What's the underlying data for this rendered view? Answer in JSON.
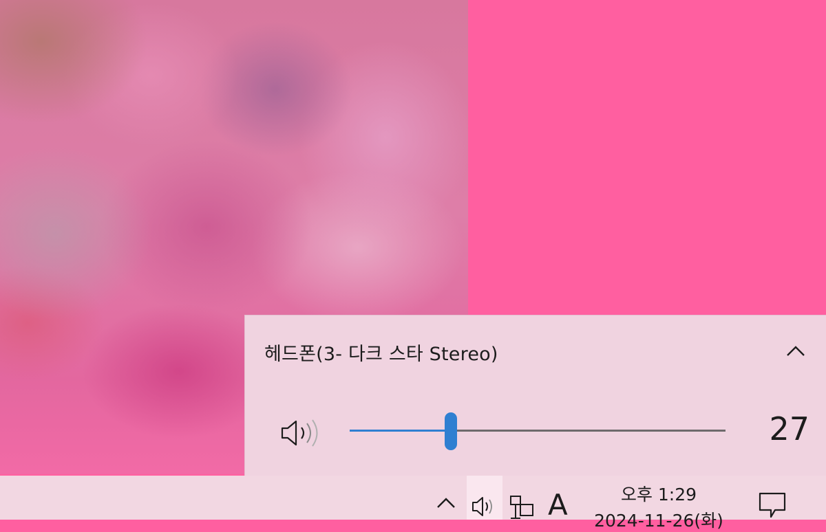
{
  "colors": {
    "wallpaper": "#ff5fa0",
    "flyout_background": "#f0d3e0",
    "taskbar_background": "#f2d7e2",
    "accent": "#2f7fd1",
    "text": "#1c1c1c"
  },
  "volume_flyout": {
    "device_name": "헤드폰(3- 다크 스타 Stereo)",
    "expand_icon": "chevron-up-icon",
    "speaker_icon": "speaker-icon",
    "volume": 27,
    "volume_fraction": 0.27
  },
  "taskbar": {
    "tray_icons": [
      "chevron-up-icon",
      "speaker-icon",
      "network-icon"
    ],
    "ime_indicator": "A",
    "clock": {
      "time": "오후 1:29",
      "date": "2024-11-26(화)"
    },
    "notification_icon": "notification-icon"
  }
}
